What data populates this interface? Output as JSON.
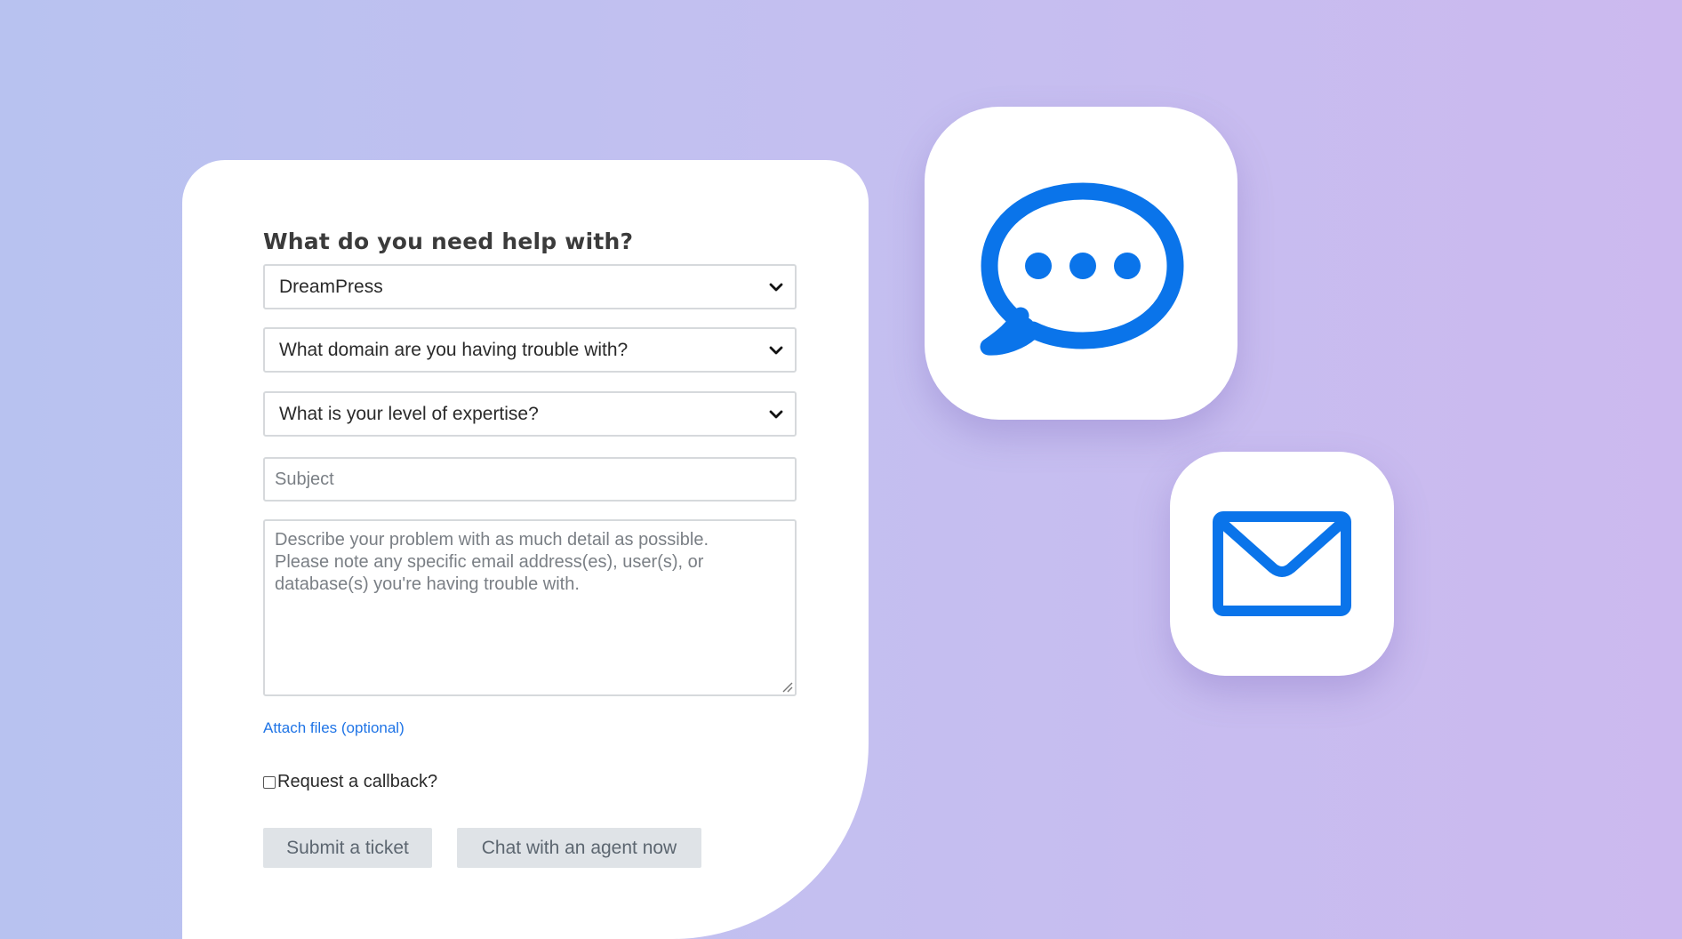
{
  "form": {
    "title": "What do you need help with?",
    "product_select": {
      "value": "DreamPress"
    },
    "domain_select": {
      "value": "What domain are you having trouble with?"
    },
    "expertise_select": {
      "value": "What is your level of expertise?"
    },
    "subject": {
      "placeholder": "Subject"
    },
    "description": {
      "placeholder_lines": [
        "Describe your problem with as much detail as possible.",
        "Please note any specific email address(es), user(s), or",
        "database(s) you're having trouble with."
      ]
    },
    "attach_link": "Attach files (optional)",
    "callback_label": "Request a callback?",
    "submit_button": "Submit a ticket",
    "chat_button": "Chat with an agent now"
  },
  "icons": {
    "chat": "chat-bubble-icon",
    "mail": "envelope-icon"
  },
  "colors": {
    "accent_blue": "#0a74ea",
    "link_blue": "#1f74e6",
    "button_gray": "#dfe3e7",
    "background_start": "#b8c2f0",
    "background_end": "#ccb9ef"
  }
}
